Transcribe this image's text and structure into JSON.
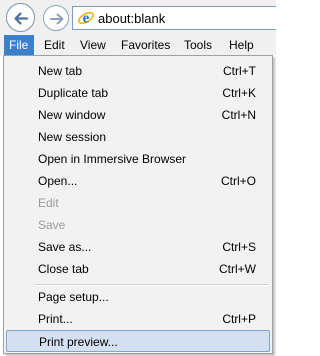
{
  "address": {
    "url": "about:blank"
  },
  "menubar": {
    "items": [
      {
        "label": "File",
        "active": true
      },
      {
        "label": "Edit"
      },
      {
        "label": "View"
      },
      {
        "label": "Favorites"
      },
      {
        "label": "Tools"
      },
      {
        "label": "Help"
      }
    ]
  },
  "file_menu": {
    "items": [
      {
        "label": "New tab",
        "shortcut": "Ctrl+T"
      },
      {
        "label": "Duplicate tab",
        "shortcut": "Ctrl+K"
      },
      {
        "label": "New window",
        "shortcut": "Ctrl+N"
      },
      {
        "label": "New session",
        "shortcut": ""
      },
      {
        "label": "Open in Immersive Browser",
        "shortcut": ""
      },
      {
        "label": "Open...",
        "shortcut": "Ctrl+O"
      },
      {
        "label": "Edit",
        "shortcut": "",
        "disabled": true
      },
      {
        "label": "Save",
        "shortcut": "",
        "disabled": true
      },
      {
        "label": "Save as...",
        "shortcut": "Ctrl+S"
      },
      {
        "label": "Close tab",
        "shortcut": "Ctrl+W"
      },
      {
        "label": "Page setup...",
        "shortcut": ""
      },
      {
        "label": "Print...",
        "shortcut": "Ctrl+P"
      },
      {
        "label": "Print preview...",
        "shortcut": "",
        "highlighted": true
      }
    ]
  },
  "colors": {
    "menubar_active": "#3c7fcb",
    "highlight": "#d5e1f2",
    "disabled_text": "#9a9a9a"
  },
  "icons": {
    "back": "back-arrow-icon",
    "forward": "forward-arrow-icon",
    "browser": "ie-logo-icon"
  }
}
